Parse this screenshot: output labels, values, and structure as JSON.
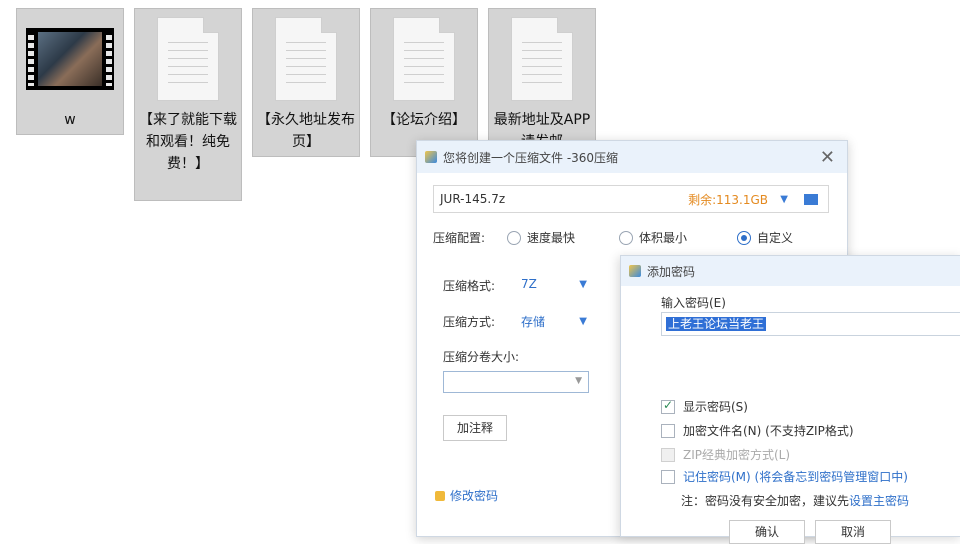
{
  "desktop": {
    "files": [
      {
        "label": "w",
        "type": "video"
      },
      {
        "label": "【来了就能下载和观看！纯免费！】",
        "type": "doc"
      },
      {
        "label": "【永久地址发布页】",
        "type": "doc"
      },
      {
        "label": "【论坛介绍】",
        "type": "doc"
      },
      {
        "label": "最新地址及APP请发邮",
        "type": "doc"
      }
    ]
  },
  "compress_dialog": {
    "title": "您将创建一个压缩文件 -360压缩",
    "filename": "JUR-145.7z",
    "free_space": "剩余:113.1GB",
    "config_label": "压缩配置:",
    "options": [
      "速度最快",
      "体积最小",
      "自定义"
    ],
    "selected_option": "自定义",
    "format_label": "压缩格式:",
    "format_value": "7Z",
    "method_label": "压缩方式:",
    "method_value": "存储",
    "split_label": "压缩分卷大小:",
    "comment_button": "加注释",
    "change_password": "修改密码"
  },
  "password_dialog": {
    "title": "添加密码",
    "input_label": "输入密码(E)",
    "password_value": "上老王论坛当老王",
    "show_password": "显示密码(S)",
    "encrypt_names": "加密文件名(N) (不支持ZIP格式)",
    "zip_classic": "ZIP经典加密方式(L)",
    "remember": "记住密码(M) (将会备忘到密码管理窗口中)",
    "note_prefix": "注：密码没有安全加密，建议先",
    "note_link": "设置主密码",
    "ok_button": "确认",
    "cancel_button": "取消"
  }
}
